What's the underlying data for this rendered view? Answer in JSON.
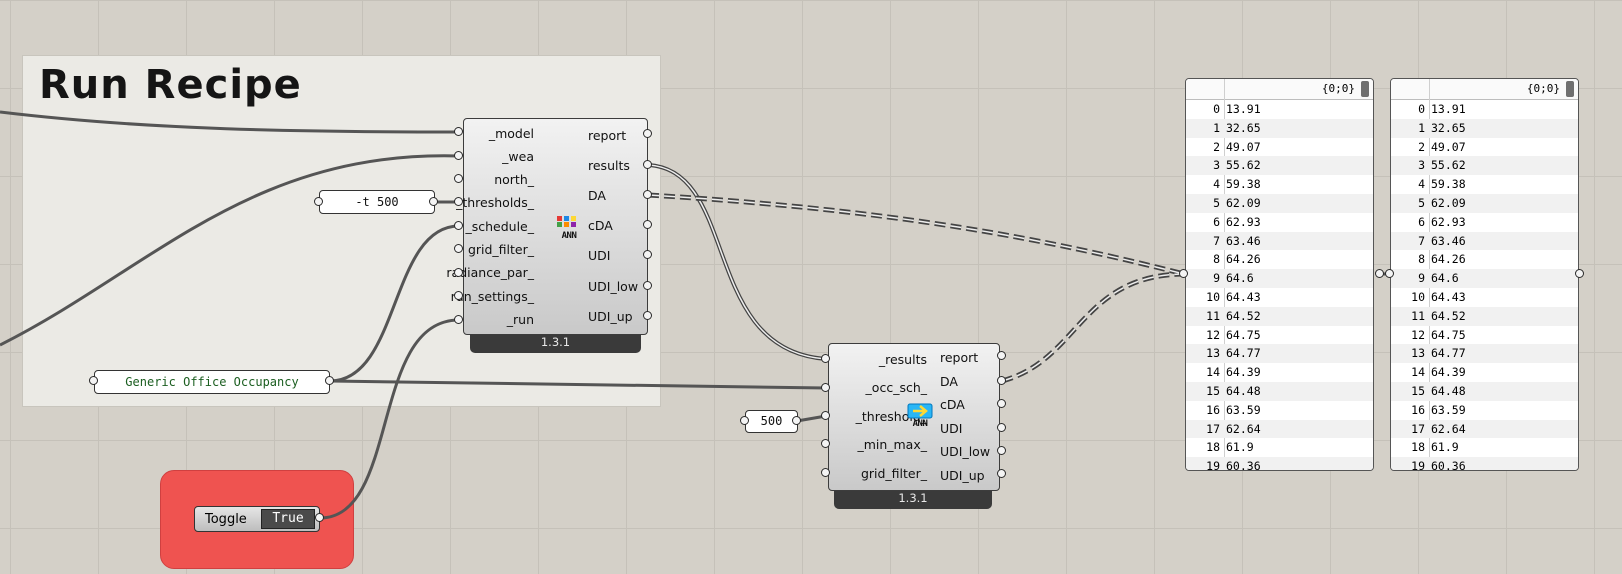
{
  "group": {
    "title": "Run Recipe"
  },
  "run_recipe": {
    "inputs": [
      "_model",
      "_wea",
      "north_",
      "_thresholds_",
      "_schedule_",
      "grid_filter_",
      "radiance_par_",
      "run_settings_",
      "_run"
    ],
    "outputs": [
      "report",
      "results",
      "DA",
      "cDA",
      "UDI",
      "UDI_low",
      "UDI_up"
    ],
    "icon_text": "ANN",
    "version": "1.3.1"
  },
  "results_component": {
    "inputs": [
      "_results",
      "_occ_sch_",
      "_threshold_",
      "_min_max_",
      "grid_filter_"
    ],
    "outputs": [
      "report",
      "DA",
      "cDA",
      "UDI",
      "UDI_low",
      "UDI_up"
    ],
    "icon_text": "ANN",
    "version": "1.3.1"
  },
  "params": {
    "thresholds": "-t 500",
    "schedule": "Generic Office Occupancy",
    "threshold": "500"
  },
  "toggle": {
    "label": "Toggle",
    "value": "True"
  },
  "panels": [
    {
      "path": "{0;0}",
      "rows": [
        {
          "i": "0",
          "v": "13.91"
        },
        {
          "i": "1",
          "v": "32.65"
        },
        {
          "i": "2",
          "v": "49.07"
        },
        {
          "i": "3",
          "v": "55.62"
        },
        {
          "i": "4",
          "v": "59.38"
        },
        {
          "i": "5",
          "v": "62.09"
        },
        {
          "i": "6",
          "v": "62.93"
        },
        {
          "i": "7",
          "v": "63.46"
        },
        {
          "i": "8",
          "v": "64.26"
        },
        {
          "i": "9",
          "v": "64.6"
        },
        {
          "i": "10",
          "v": "64.43"
        },
        {
          "i": "11",
          "v": "64.52"
        },
        {
          "i": "12",
          "v": "64.75"
        },
        {
          "i": "13",
          "v": "64.77"
        },
        {
          "i": "14",
          "v": "64.39"
        },
        {
          "i": "15",
          "v": "64.48"
        },
        {
          "i": "16",
          "v": "63.59"
        },
        {
          "i": "17",
          "v": "62.64"
        },
        {
          "i": "18",
          "v": "61.9"
        },
        {
          "i": "19",
          "v": "60.36"
        }
      ]
    },
    {
      "path": "{0;0}",
      "rows": [
        {
          "i": "0",
          "v": "13.91"
        },
        {
          "i": "1",
          "v": "32.65"
        },
        {
          "i": "2",
          "v": "49.07"
        },
        {
          "i": "3",
          "v": "55.62"
        },
        {
          "i": "4",
          "v": "59.38"
        },
        {
          "i": "5",
          "v": "62.09"
        },
        {
          "i": "6",
          "v": "62.93"
        },
        {
          "i": "7",
          "v": "63.46"
        },
        {
          "i": "8",
          "v": "64.26"
        },
        {
          "i": "9",
          "v": "64.6"
        },
        {
          "i": "10",
          "v": "64.43"
        },
        {
          "i": "11",
          "v": "64.52"
        },
        {
          "i": "12",
          "v": "64.75"
        },
        {
          "i": "13",
          "v": "64.77"
        },
        {
          "i": "14",
          "v": "64.39"
        },
        {
          "i": "15",
          "v": "64.48"
        },
        {
          "i": "16",
          "v": "63.59"
        },
        {
          "i": "17",
          "v": "62.64"
        },
        {
          "i": "18",
          "v": "61.9"
        },
        {
          "i": "19",
          "v": "60.36"
        }
      ]
    }
  ]
}
